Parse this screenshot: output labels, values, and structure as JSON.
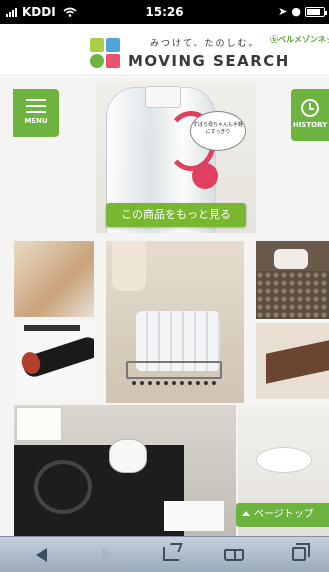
{
  "status_bar": {
    "carrier": "KDDI",
    "time": "15:26",
    "icons": [
      "signal-icon",
      "wifi-icon",
      "location-arrow-icon",
      "clock-icon",
      "battery-icon"
    ]
  },
  "header": {
    "tagline": "みつけて、たのしむ。",
    "title": "MOVING SEARCH",
    "partner": "ベルメゾンネット",
    "logo_colors": [
      "#a8cf45",
      "#4fa3d9",
      "#6db33f",
      "#e8556b"
    ]
  },
  "buttons": {
    "menu_label": "MENU",
    "history_label": "HISTORY",
    "cta_label": "この商品をもっと見る",
    "page_top_label": "ページトップ"
  },
  "hero": {
    "speech_text": "ずぼら母ちゃんも手軽にすっきり"
  },
  "toolbar": {
    "icons": [
      "back-icon",
      "forward-icon",
      "share-icon",
      "bookmarks-icon",
      "tabs-icon"
    ]
  },
  "colors": {
    "accent_green": "#6db33f",
    "toolbar_top": "#c6d0dc",
    "toolbar_bottom": "#9aa9bb"
  }
}
